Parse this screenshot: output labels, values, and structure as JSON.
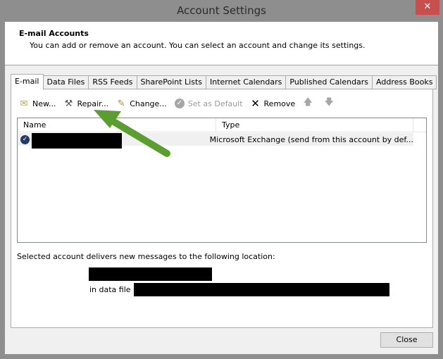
{
  "window": {
    "title": "Account Settings",
    "close_icon": "close-icon"
  },
  "header": {
    "title": "E-mail Accounts",
    "description": "You can add or remove an account. You can select an account and change its settings."
  },
  "tabs": [
    {
      "label": "E-mail",
      "active": true
    },
    {
      "label": "Data Files",
      "active": false
    },
    {
      "label": "RSS Feeds",
      "active": false
    },
    {
      "label": "SharePoint Lists",
      "active": false
    },
    {
      "label": "Internet Calendars",
      "active": false
    },
    {
      "label": "Published Calendars",
      "active": false
    },
    {
      "label": "Address Books",
      "active": false
    }
  ],
  "toolbar": {
    "new_label": "New...",
    "repair_label": "Repair...",
    "change_label": "Change...",
    "set_default_label": "Set as Default",
    "remove_label": "Remove"
  },
  "list": {
    "columns": [
      "Name",
      "Type"
    ],
    "rows": [
      {
        "name": "[redacted]",
        "type": "Microsoft Exchange (send from this account by def..."
      }
    ]
  },
  "delivery": {
    "label": "Selected account delivers new messages to the following location:",
    "location": "[redacted]",
    "data_file_prefix": "in data file",
    "data_file": "[redacted]"
  },
  "footer": {
    "close_label": "Close"
  },
  "annotation": {
    "arrow_color": "#5a9e2f",
    "points_to": "Repair..."
  }
}
